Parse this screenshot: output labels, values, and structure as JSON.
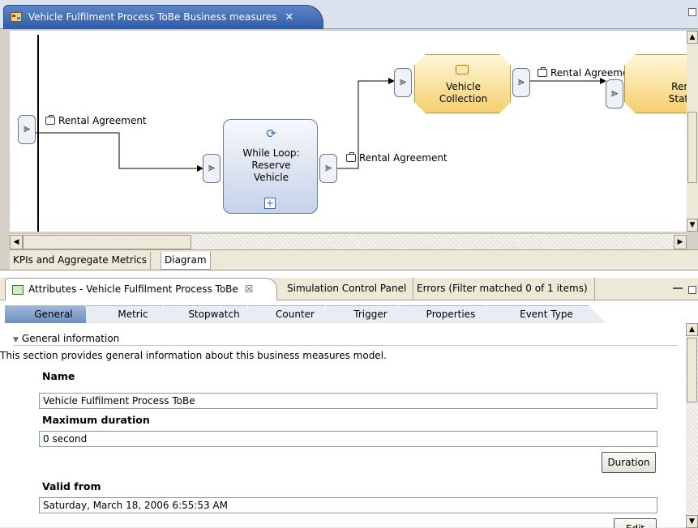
{
  "editor": {
    "tab_title": "Vehicle Fulfilment Process ToBe Business measures",
    "close_glyph": "✕",
    "bottom_tabs": [
      {
        "label": "KPIs and Aggregate Metrics"
      },
      {
        "label": "Diagram"
      }
    ],
    "scroll_glyphs": {
      "up": "▲",
      "down": "▼",
      "left": "◀",
      "right": "▶"
    }
  },
  "diagram": {
    "labels": {
      "rental_agreement_1": "Rental Agreement",
      "rental_agreement_2": "Rental Agreement",
      "rental_agreement_3": "Rental Agreement"
    },
    "nodes": {
      "while_loop": {
        "line1": "While Loop:",
        "line2": "Reserve",
        "line3": "Vehicle",
        "expand_glyph": "+"
      },
      "vehicle_collection": {
        "line1": "Vehicle",
        "line2": "Collection"
      },
      "rental_status": {
        "line1": "Renta",
        "line2": "Status"
      }
    },
    "port_glyph": "⪢"
  },
  "attributes_view": {
    "tabs": [
      {
        "label": "Attributes - Vehicle Fulfilment Process ToBe",
        "close_glyph": "☒"
      },
      {
        "label": "Simulation Control Panel"
      },
      {
        "label": "Errors (Filter matched 0 of 1 items)"
      }
    ],
    "property_tabs": [
      "General",
      "Metric",
      "Stopwatch",
      "Counter",
      "Trigger",
      "Properties",
      "Event Type"
    ],
    "active_property_tab": "General",
    "section": {
      "title": "General information",
      "description": "This section provides general information about this business measures model."
    },
    "fields": {
      "name_label": "Name",
      "name_value": "Vehicle Fulfilment Process ToBe",
      "max_duration_label": "Maximum duration",
      "max_duration_value": "0 second",
      "duration_button": "Duration",
      "valid_from_label": "Valid from",
      "valid_from_value": "Saturday, March 18, 2006 6:55:53 AM",
      "edit_button": "Edit"
    }
  },
  "colors": {
    "editor_tab": "#2f5aa8",
    "active_property_tab": "#6c8fc0",
    "process_node": "#f6cf6e",
    "task_node": "#c5d2e8"
  }
}
